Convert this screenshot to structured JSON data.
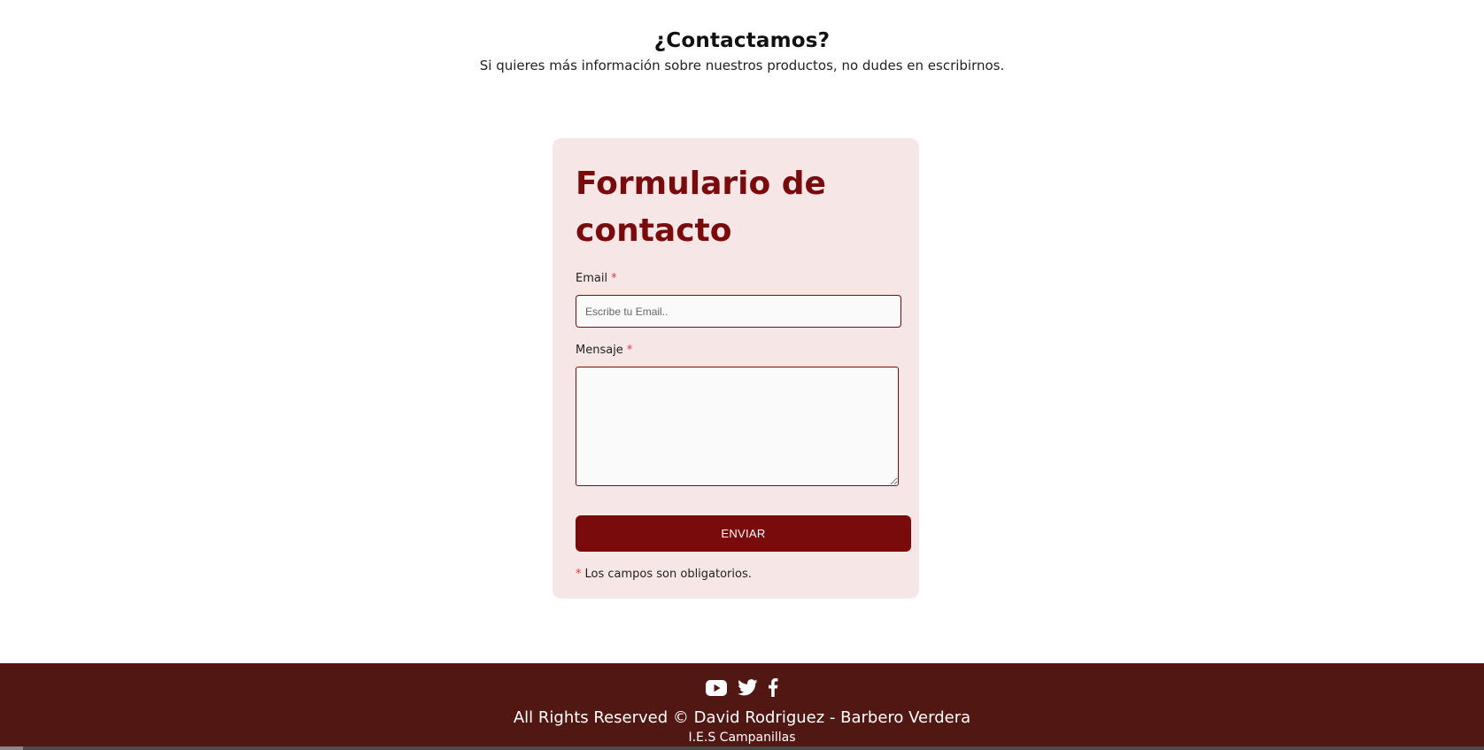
{
  "intro": {
    "title": "¿Contactamos?",
    "subtitle": "Si quieres más información sobre nuestros productos, no dudes en escribirnos."
  },
  "form": {
    "title": "Formulario de contacto",
    "email_label": "Email",
    "email_placeholder": "Escribe tu Email..",
    "email_value": "",
    "message_label": "Mensaje",
    "message_value": "",
    "required_mark": "*",
    "submit_label": "ENVIAR",
    "required_note": "Los campos son obligatorios."
  },
  "footer": {
    "social_icons": [
      "youtube-icon",
      "twitter-icon",
      "facebook-icon"
    ],
    "copyright": "All Rights Reserved © David Rodriguez - Barbero Verdera",
    "school": "I.E.S Campanillas"
  },
  "colors": {
    "accent": "#7a0b0d",
    "card_bg": "#f6e6e6",
    "footer_bg": "#501713",
    "required": "#d94040"
  }
}
